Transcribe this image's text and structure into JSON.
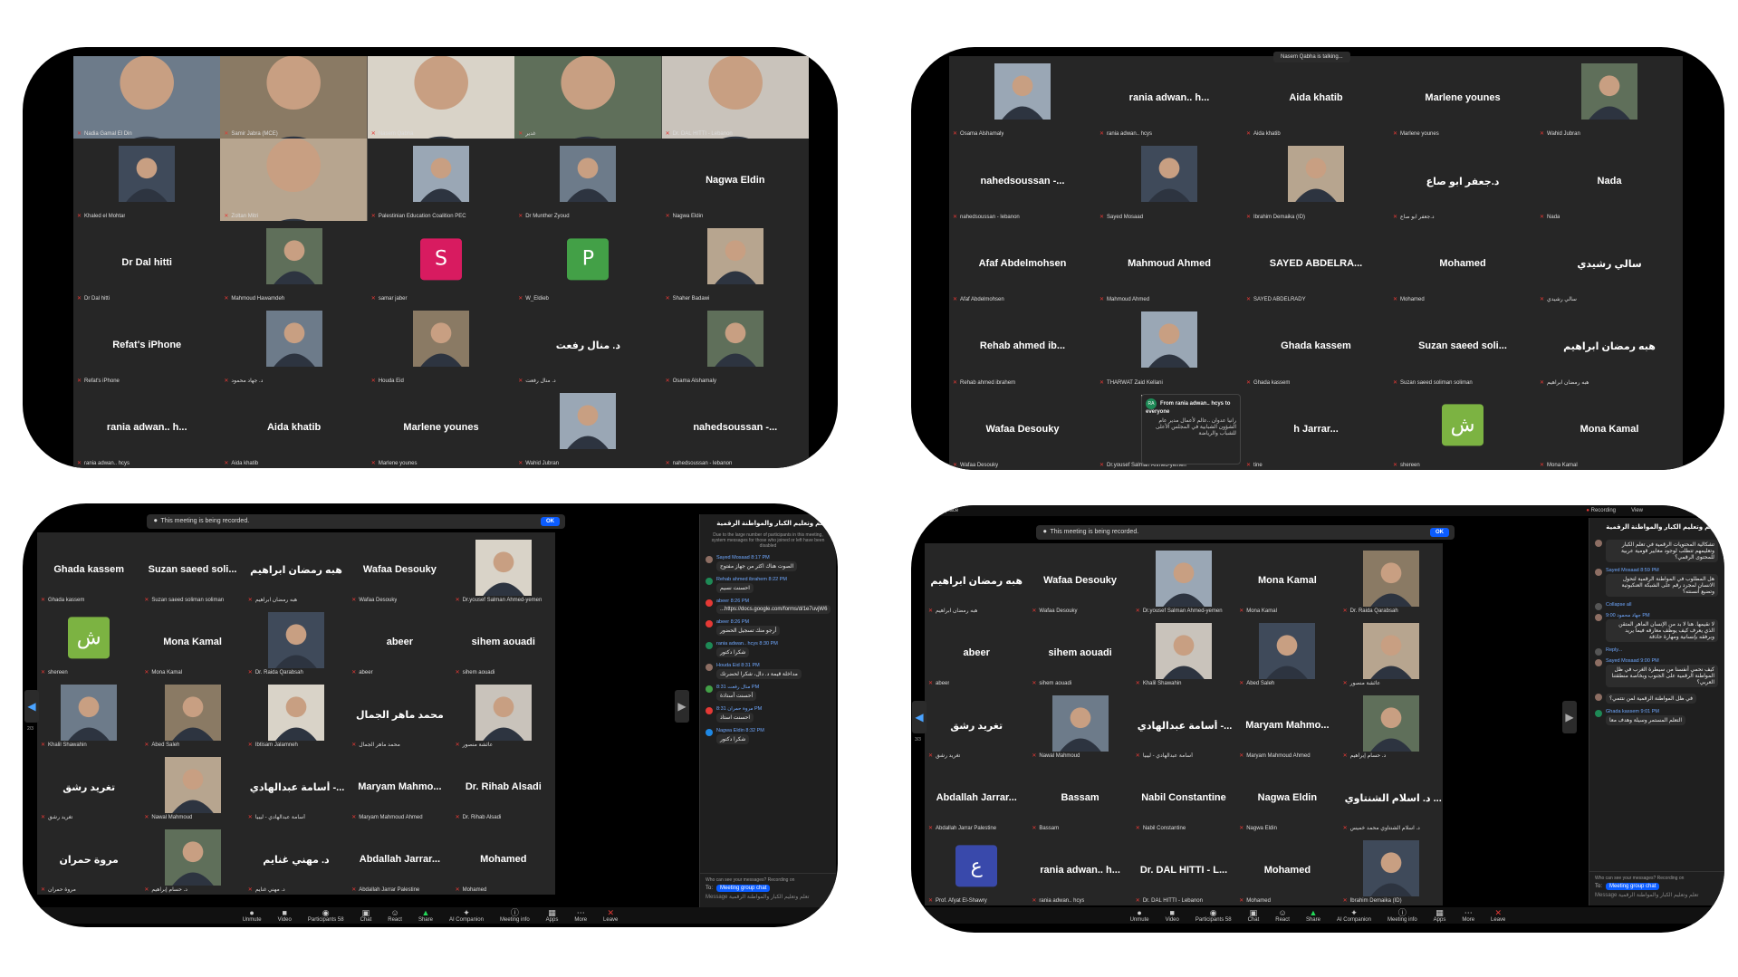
{
  "panels": [
    {
      "id": "top-left",
      "tiles": [
        {
          "name": "",
          "label": "Nadia Gamal El Din",
          "kind": "photo"
        },
        {
          "name": "",
          "label": "Samir Jabra (MCE)",
          "kind": "photo"
        },
        {
          "name": "",
          "label": "Nasem Qabha",
          "kind": "photo",
          "active": true
        },
        {
          "name": "",
          "label": "غدير",
          "kind": "photo"
        },
        {
          "name": "",
          "label": "Dr. DAL HITTI - Lebanon",
          "kind": "photo"
        },
        {
          "name": "",
          "label": "Khaled el Mohtar",
          "kind": "photo"
        },
        {
          "name": "",
          "label": "Zoltan Mitri",
          "kind": "photo"
        },
        {
          "name": "",
          "label": "Palestinian Education Coalition PEC",
          "kind": "photo"
        },
        {
          "name": "",
          "label": "Dr Munther Zyoud",
          "kind": "photo"
        },
        {
          "name": "Nagwa Eldin",
          "label": "Nagwa Eldin",
          "kind": "name"
        },
        {
          "name": "Dr Dal hitti",
          "label": "Dr Dal hitti",
          "kind": "name"
        },
        {
          "name": "",
          "label": "Mahmoud Hawamdeh",
          "kind": "photo"
        },
        {
          "name": "",
          "label": "samar jaber",
          "kind": "avatar",
          "letter": "S",
          "color": "#d81b60"
        },
        {
          "name": "",
          "label": "W_Eldieb",
          "kind": "avatar",
          "letter": "P",
          "color": "#43a047"
        },
        {
          "name": "",
          "label": "Shaher Badawi",
          "kind": "photo"
        },
        {
          "name": "Refat's iPhone",
          "label": "Refat's iPhone",
          "kind": "name"
        },
        {
          "name": "",
          "label": "د. جهاد محمود",
          "kind": "photo"
        },
        {
          "name": "",
          "label": "Houda Eid",
          "kind": "photo"
        },
        {
          "name": "د. منال رفعت",
          "label": "د. منال رفعت",
          "kind": "name"
        },
        {
          "name": "",
          "label": "Osama Alshamaly",
          "kind": "photo"
        },
        {
          "name": "rania   adwan.. h...",
          "label": "rania  adwan.. hcys",
          "kind": "name"
        },
        {
          "name": "Aida khatib",
          "label": "Aida khatib",
          "kind": "name"
        },
        {
          "name": "Marlene younes",
          "label": "Marlene younes",
          "kind": "name"
        },
        {
          "name": "",
          "label": "Wahid Jubran",
          "kind": "photo"
        },
        {
          "name": "nahedsoussan   -...",
          "label": "nahedsoussan - lebanon",
          "kind": "name"
        }
      ]
    },
    {
      "id": "top-right",
      "talking": "Nasem Qabha is talking...",
      "tiles": [
        {
          "name": "",
          "label": "Osama Alshamaly",
          "kind": "photo"
        },
        {
          "name": "rania   adwan.. h...",
          "label": "rania  adwan.. hcys",
          "kind": "name"
        },
        {
          "name": "Aida khatib",
          "label": "Aida khatib",
          "kind": "name"
        },
        {
          "name": "Marlene younes",
          "label": "Marlene younes",
          "kind": "name"
        },
        {
          "name": "",
          "label": "Wahid Jubran",
          "kind": "photo"
        },
        {
          "name": "nahedsoussan   -...",
          "label": "nahedsoussan - lebanon",
          "kind": "name"
        },
        {
          "name": "",
          "label": "Sayed Mosaad",
          "kind": "photo"
        },
        {
          "name": "",
          "label": "Ibrahim Demaika (ID)",
          "kind": "photo"
        },
        {
          "name": "د.جعفر ابو صاع",
          "label": "د.جعفر ابو صاع",
          "kind": "name"
        },
        {
          "name": "Nada",
          "label": "Nada",
          "kind": "name"
        },
        {
          "name": "Afaf Abdelmohsen",
          "label": "Afaf Abdelmohsen",
          "kind": "name"
        },
        {
          "name": "Mahmoud Ahmed",
          "label": "Mahmoud Ahmed",
          "kind": "name"
        },
        {
          "name": "SAYED   ABDELRA...",
          "label": "SAYED ABDELRADY",
          "kind": "name"
        },
        {
          "name": "Mohamed",
          "label": "Mohamed",
          "kind": "name"
        },
        {
          "name": "سالي رشيدي",
          "label": "سالي رشيدي",
          "kind": "name"
        },
        {
          "name": "Rehab ahmed ib...",
          "label": "Rehab ahmed ibrahem",
          "kind": "name"
        },
        {
          "name": "",
          "label": "THARWAT Zaid Kellani",
          "kind": "photo"
        },
        {
          "name": "Ghada kassem",
          "label": "Ghada kassem",
          "kind": "name"
        },
        {
          "name": "Suzan saeed soli...",
          "label": "Suzan saeed soliman soliman",
          "kind": "name"
        },
        {
          "name": "هبه رمضان ابراهيم",
          "label": "هبه رمضان ابراهيم",
          "kind": "name"
        },
        {
          "name": "Wafaa Desouky",
          "label": "Wafaa Desouky",
          "kind": "name"
        },
        {
          "name": "",
          "label": "Dr.yousef Salman Ahmed-yemen",
          "kind": "photo"
        },
        {
          "name": "h Jarrar...",
          "label": "tine",
          "kind": "name"
        },
        {
          "name": "",
          "label": "shereen",
          "kind": "avatar",
          "letter": "ش",
          "color": "#7cb342"
        },
        {
          "name": "Mona Kamal",
          "label": "Mona Kamal",
          "kind": "name"
        }
      ],
      "popup": {
        "from": "From rania   adwan.. hcys to everyone",
        "badge": "RA",
        "text": "رانيا عدوان ..عالم لأعمال مدير عام الشؤون الشبابية في المجلس الأعلى للشباب والرياضة"
      }
    },
    {
      "id": "bottom-left",
      "banner": "This meeting is being recorded.",
      "ok": "OK",
      "page": "2/3",
      "tiles": [
        {
          "name": "Ghada kassem",
          "label": "Ghada kassem",
          "kind": "name"
        },
        {
          "name": "Suzan saeed soli...",
          "label": "Suzan saeed soliman soliman",
          "kind": "name"
        },
        {
          "name": "هبه رمضان ابراهيم",
          "label": "هبه رمضان ابراهيم",
          "kind": "name"
        },
        {
          "name": "Wafaa Desouky",
          "label": "Wafaa Desouky",
          "kind": "name"
        },
        {
          "name": "",
          "label": "Dr.yousef Salman Ahmed-yemen",
          "kind": "photo"
        },
        {
          "name": "",
          "label": "shereen",
          "kind": "avatar",
          "letter": "ش",
          "color": "#7cb342"
        },
        {
          "name": "Mona Kamal",
          "label": "Mona Kamal",
          "kind": "name"
        },
        {
          "name": "",
          "label": "Dr. Raida Qarabsah",
          "kind": "photo"
        },
        {
          "name": "abeer",
          "label": "abeer",
          "kind": "name"
        },
        {
          "name": "sihem aouadi",
          "label": "sihem aouadi",
          "kind": "name"
        },
        {
          "name": "",
          "label": "Khalil Shawahin",
          "kind": "photo"
        },
        {
          "name": "",
          "label": "Abed Saleh",
          "kind": "photo"
        },
        {
          "name": "",
          "label": "Ibtisam Jalamneh",
          "kind": "photo"
        },
        {
          "name": "محمد ماهر الجمال",
          "label": "محمد ماهر الجمال",
          "kind": "name"
        },
        {
          "name": "",
          "label": "عائشة منصور",
          "kind": "photo"
        },
        {
          "name": "تغريد رشق",
          "label": "تغريد رشق",
          "kind": "name"
        },
        {
          "name": "",
          "label": "Nawal Mahmoud",
          "kind": "photo"
        },
        {
          "name": "أسامة عبدالهادي -...",
          "label": "أسامة عبدالهادي - ليبيا",
          "kind": "name"
        },
        {
          "name": "Maryam  Mahmo...",
          "label": "Maryam Mahmoud Ahmed",
          "kind": "name"
        },
        {
          "name": "Dr. Rihab Alsadi",
          "label": "Dr. Rihab Alsadi",
          "kind": "name"
        },
        {
          "name": "مروة حمران",
          "label": "مروة حمران",
          "kind": "name"
        },
        {
          "name": "",
          "label": "د. حسام إبراهيم",
          "kind": "photo"
        },
        {
          "name": "د. مهني غنايم",
          "label": "د. مهني غنايم",
          "kind": "name"
        },
        {
          "name": "Abdallah  Jarrar...",
          "label": "Abdallah Jarrar Palestine",
          "kind": "name"
        },
        {
          "name": "Mohamed",
          "label": "Mohamed",
          "kind": "name"
        }
      ],
      "chat": {
        "title": "تعلم وتعليم الكبار والمواطنة الرقمية",
        "notice": "Due to the large number of participants in this meeting, system messages for those who joined or left have been disabled",
        "messages": [
          {
            "who": "Sayed Mosaad 8:17 PM",
            "text": "الصوت هناك اكثر من جهاز مفتوح",
            "color": "#8d6e63"
          },
          {
            "who": "Rehab ahmed ibrahem 8:22 PM",
            "text": "احسنت نسيم",
            "color": "#1e8a56"
          },
          {
            "who": "abeer 8:26 PM",
            "text": "https://docs.google.com/forms/d/1e7uvjW6...",
            "color": "#e53935"
          },
          {
            "who": "abeer 8:26 PM",
            "text": "أرجو منك تسجيل الحضور",
            "color": "#e53935"
          },
          {
            "who": "rania  adwan.. hcys 8:30 PM",
            "text": "شكرا دكتور",
            "color": "#1e8a56"
          },
          {
            "who": "Houda Eid 8:31 PM",
            "text": "مداخلة قيمة د. دال، شكرا لحضرتك",
            "color": "#8d6e63"
          },
          {
            "who": "منال رفعت 8:31 PM",
            "text": "أحسنت أستاذة",
            "color": "#43a047"
          },
          {
            "who": "مروة حمران 8:31 PM",
            "text": "احسنت استاذ",
            "color": "#e53935"
          },
          {
            "who": "Nagwa Eldin 8:32 PM",
            "text": "شكرا دكتور",
            "color": "#1e88e5"
          }
        ],
        "who_can_see": "Who can see your messages? Recording on",
        "to_label": "To:",
        "to_value": "Meeting group chat",
        "placeholder": "Message تعلم وتعليم الكبار والمواطنة الرقمية"
      },
      "toolbar": [
        "Unmute",
        "Video",
        "Participants 58",
        "Chat",
        "React",
        "Share",
        "AI Companion",
        "Meeting info",
        "Apps",
        "More",
        "Leave"
      ]
    },
    {
      "id": "bottom-right",
      "topbar": "Workplace",
      "recording": "Recording",
      "view": "View",
      "banner": "This meeting is being recorded.",
      "ok": "OK",
      "page": "3/3",
      "tiles": [
        {
          "name": "هبه رمضان ابراهيم",
          "label": "هبه رمضان ابراهيم",
          "kind": "name"
        },
        {
          "name": "Wafaa Desouky",
          "label": "Wafaa Desouky",
          "kind": "name"
        },
        {
          "name": "",
          "label": "Dr.yousef Salman Ahmed-yemen",
          "kind": "photo"
        },
        {
          "name": "Mona Kamal",
          "label": "Mona Kamal",
          "kind": "name"
        },
        {
          "name": "",
          "label": "Dr. Raida Qarabsah",
          "kind": "photo"
        },
        {
          "name": "abeer",
          "label": "abeer",
          "kind": "name"
        },
        {
          "name": "sihem aouadi",
          "label": "sihem aouadi",
          "kind": "name"
        },
        {
          "name": "",
          "label": "Khalil Shawahin",
          "kind": "photo"
        },
        {
          "name": "",
          "label": "Abed Saleh",
          "kind": "photo"
        },
        {
          "name": "",
          "label": "عائشة منصور",
          "kind": "photo"
        },
        {
          "name": "تغريد رشق",
          "label": "تغريد رشق",
          "kind": "name"
        },
        {
          "name": "",
          "label": "Nawal Mahmoud",
          "kind": "photo"
        },
        {
          "name": "أسامة عبدالهادي -...",
          "label": "أسامة عبدالهادي - ليبيا",
          "kind": "name"
        },
        {
          "name": "Maryam  Mahmo...",
          "label": "Maryam Mahmoud Ahmed",
          "kind": "name"
        },
        {
          "name": "",
          "label": "د. حسام إبراهيم",
          "kind": "photo"
        },
        {
          "name": "Abdallah  Jarrar...",
          "label": "Abdallah Jarrar Palestine",
          "kind": "name"
        },
        {
          "name": "Bassam",
          "label": "Bassam",
          "kind": "name"
        },
        {
          "name": "Nabil Constantine",
          "label": "Nabil Constantine",
          "kind": "name"
        },
        {
          "name": "Nagwa Eldin",
          "label": "Nagwa Eldin",
          "kind": "name"
        },
        {
          "name": "د. اسلام الشنتاوي ...",
          "label": "د. اسلام الشنتاوي محمد خميس",
          "kind": "name"
        },
        {
          "name": "",
          "label": "Prof. Afyat El-Shawry",
          "kind": "avatar",
          "letter": "ع",
          "color": "#3949ab"
        },
        {
          "name": "rania   adwan.. h...",
          "label": "rania  adwan.. hcys",
          "kind": "name"
        },
        {
          "name": "Dr. DAL HITTI - L...",
          "label": "Dr. DAL HITTI - Lebanon",
          "kind": "name"
        },
        {
          "name": "Mohamed",
          "label": "Mohamed",
          "kind": "name"
        },
        {
          "name": "",
          "label": "Ibrahim Demaika (ID)",
          "kind": "photo"
        }
      ],
      "chat": {
        "title": "تعلم وتعليم الكبار والمواطنة الرقمية",
        "messages": [
          {
            "who": "",
            "text": "تشكالية المحتويات الرقمية في تعلم الكبار وتعليمهم تتطلب لوجود معايير قومية عربية للمحتوى الرقمي؟",
            "color": "#8d6e63"
          },
          {
            "who": "Sayed Mosaad 8:59 PM",
            "text": "هل المطلوب في المواطنة الرقمية لتحول الانسان لمجرد رقم على الشبكة العنكبوتية وتضيع أنسنته؟",
            "color": "#8d6e63"
          },
          {
            "who": "Collapse all",
            "text": "",
            "color": "#555"
          },
          {
            "who": "جهاد محمود 9:00 PM",
            "text": "لا نقيمها. هنا لا بد من الإنسان الماهر المتقن الذي يعرف كيف يوظف معارفه فيما يريد وبرفقه بإنسانية ومهارة حاذقة",
            "color": "#8d6e63"
          },
          {
            "who": "Reply...",
            "text": "",
            "color": "#555"
          },
          {
            "who": "Sayed Mosaad 9:00 PM",
            "text": "كيف نحمي أنفسنا من سيطرة الغرب في ظل المواطنة الرقمية على الجنوب وبخاصة منطقتنا العربي؟",
            "color": "#8d6e63"
          },
          {
            "who": "",
            "text": "في ظل المواطنة الرقمية لمن نتتمي؟",
            "color": "#8d6e63"
          },
          {
            "who": "Ghada kassem 9:01 PM",
            "text": "التعلم المستمر وسيلة وهدف معا",
            "color": "#1e8a56"
          }
        ],
        "who_can_see": "Who can see your messages? Recording on",
        "to_label": "To:",
        "to_value": "Meeting group chat",
        "placeholder": "Message تعلم وتعليم الكبار والمواطنة الرقمية"
      },
      "toolbar": [
        "Unmute",
        "Video",
        "Participants 58",
        "Chat",
        "React",
        "Share",
        "AI Companion",
        "Meeting info",
        "Apps",
        "More",
        "Leave"
      ]
    }
  ]
}
